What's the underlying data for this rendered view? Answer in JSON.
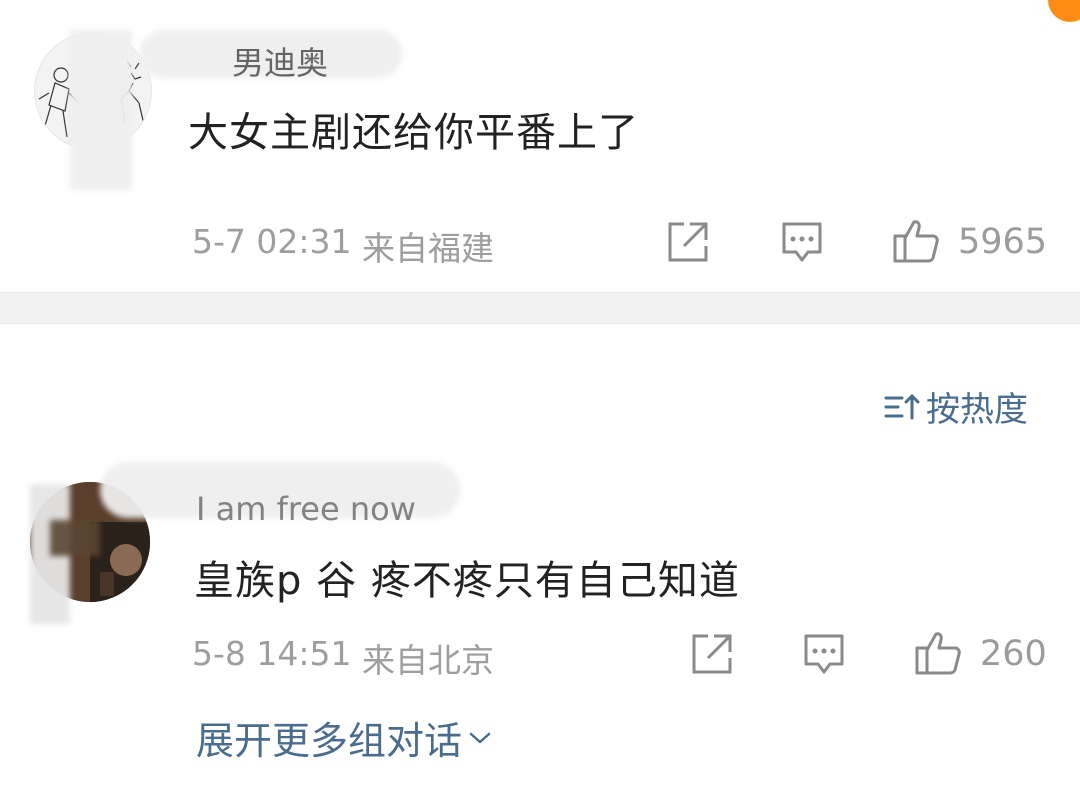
{
  "comments": [
    {
      "username": "男迪奥",
      "text": "大女主剧还给你平番上了",
      "time": "5-7 02:31",
      "location": "来自福建",
      "likes": "5965",
      "icons": [
        "share-icon",
        "reply-icon",
        "thumbs-up-icon"
      ]
    },
    {
      "username": "I am free now",
      "text": "皇族p 谷 疼不疼只有自己知道",
      "time": "5-8 14:51",
      "location": "来自北京",
      "likes": "260",
      "icons": [
        "share-icon",
        "reply-icon",
        "thumbs-up-icon"
      ]
    }
  ],
  "sort": {
    "label": "按热度",
    "icon": "sort-icon"
  },
  "expand": {
    "label": "展开更多组对话",
    "icon": "chevron-down-icon"
  },
  "colors": {
    "accent_link": "#4a6d8f",
    "meta_gray": "#9e9e9e",
    "text_dark": "#222222",
    "separator": "#f2f2f2",
    "corner_badge": "#ff8b14"
  }
}
